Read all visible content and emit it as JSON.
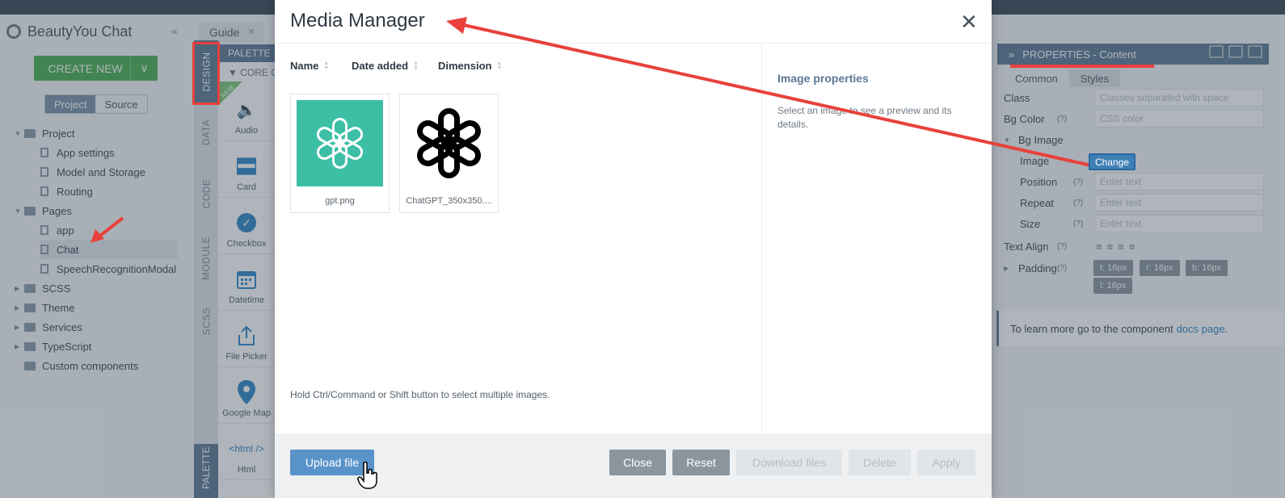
{
  "app": {
    "title": "BeautyYou Chat",
    "create_new_label": "CREATE NEW",
    "view_toggle": [
      "Project",
      "Source"
    ],
    "tree": [
      {
        "label": "Project",
        "kind": "folder",
        "expanded": true
      },
      {
        "label": "App settings",
        "kind": "item"
      },
      {
        "label": "Model and Storage",
        "kind": "item"
      },
      {
        "label": "Routing",
        "kind": "item"
      },
      {
        "label": "Pages",
        "kind": "folder",
        "expanded": true
      },
      {
        "label": "app",
        "kind": "page"
      },
      {
        "label": "Chat",
        "kind": "page",
        "selected": true
      },
      {
        "label": "SpeechRecognitionModal",
        "kind": "page"
      },
      {
        "label": "SCSS",
        "kind": "folder"
      },
      {
        "label": "Theme",
        "kind": "folder"
      },
      {
        "label": "Services",
        "kind": "folder"
      },
      {
        "label": "TypeScript",
        "kind": "folder"
      },
      {
        "label": "Custom components",
        "kind": "folder"
      }
    ],
    "editor_tab": "Guide",
    "vertical_tabs": [
      "DESIGN",
      "DATA",
      "CODE",
      "MODULE",
      "SCSS"
    ],
    "palette": {
      "header": "PALETTE",
      "section": "CORE C",
      "new_badge": "NEW",
      "items": [
        "Audio",
        "Card",
        "Checkbox",
        "Datetime",
        "File Picker",
        "Google Map",
        "Html"
      ],
      "html_glyph": "<html />",
      "bottom_tab": "PALETTE"
    },
    "properties": {
      "header": "PROPERTIES - Content",
      "tabs": [
        "Common",
        "Styles"
      ],
      "rows": {
        "class_label": "Class",
        "class_placeholder": "Classes separated with space",
        "bgcolor_label": "Bg Color",
        "bgcolor_placeholder": "CSS color",
        "bgimage_label": "Bg Image",
        "image_label": "Image",
        "change_label": "Change",
        "position_label": "Position",
        "repeat_label": "Repeat",
        "size_label": "Size",
        "textalign_label": "Text Align",
        "padding_label": "Padding",
        "enter_text": "Enter text",
        "help": "(?)"
      },
      "padding_values": [
        "t: 16px",
        "r: 16px",
        "b: 16px",
        "l: 16px"
      ],
      "info_text": "To learn more go to the component",
      "info_link": "docs page."
    }
  },
  "modal": {
    "title": "Media Manager",
    "columns": [
      "Name",
      "Date added",
      "Dimension"
    ],
    "images": [
      {
        "caption": "gpt.png",
        "style": "teal"
      },
      {
        "caption": "ChatGPT_350x350....",
        "style": "black"
      }
    ],
    "hint": "Hold Ctrl/Command or Shift button to select multiple images.",
    "properties_title": "Image properties",
    "properties_desc": "Select an image to see a preview and its details.",
    "buttons": {
      "upload": "Upload file",
      "close": "Close",
      "reset": "Reset",
      "download": "Download files",
      "delete": "Delete",
      "apply": "Apply"
    }
  },
  "colors": {
    "accent": "#5c7894",
    "primary_button": "#5a93c9",
    "create_green": "#4caf50",
    "annotation_red": "#e8413c",
    "teal_logo": "#3dbfa6"
  }
}
